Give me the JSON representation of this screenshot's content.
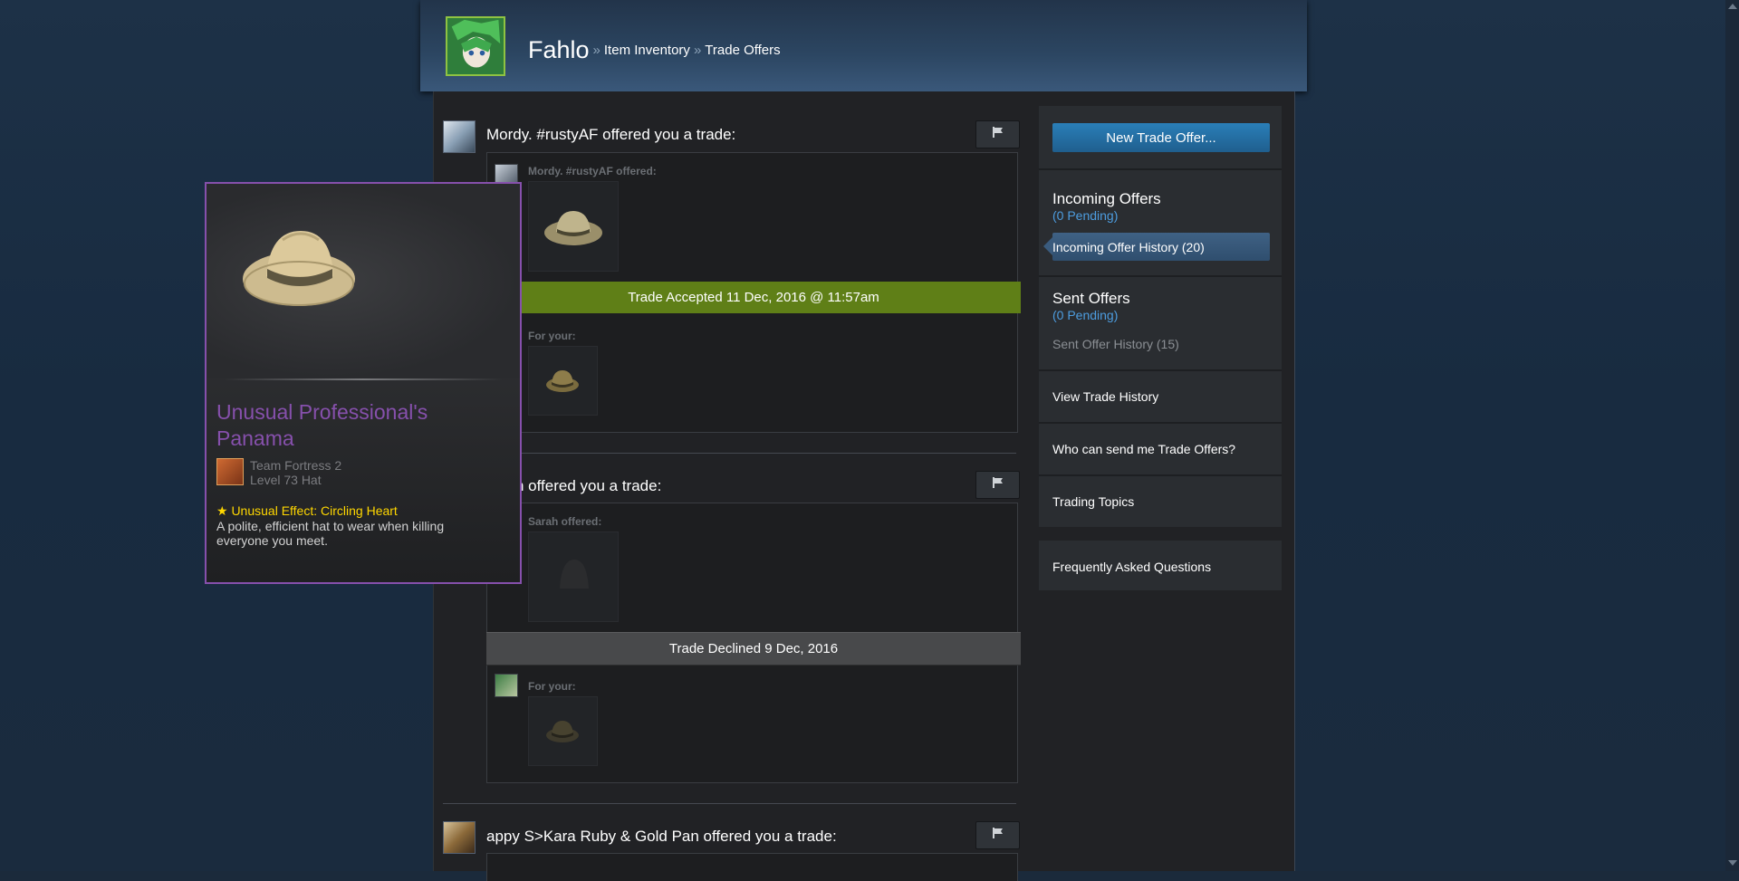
{
  "header": {
    "profile_name": "Fahlo",
    "separator": "»",
    "crumb_inventory": "Item Inventory",
    "crumb_trade_offers": "Trade Offers"
  },
  "offers": [
    {
      "title": "Mordy. #rustyAF offered you a trade:",
      "them_label": "Mordy. #rustyAF offered:",
      "status": "Trade Accepted 11 Dec, 2016 @ 11:57am",
      "status_kind": "accepted",
      "status_color": "#5f7f17",
      "your_label": "For your:"
    },
    {
      "title_visible": "n offered you a trade:",
      "them_label": "Sarah offered:",
      "status": "Trade Declined 9 Dec, 2016",
      "status_kind": "declined",
      "status_color": "#48494b",
      "your_label": "For your:"
    },
    {
      "title": "appy S>Kara Ruby & Gold Pan offered you a trade:"
    }
  ],
  "sidebar": {
    "new_offer": "New Trade Offer...",
    "incoming_head": "Incoming Offers",
    "incoming_pending": "(0 Pending)",
    "incoming_history": "Incoming Offer History (20)",
    "sent_head": "Sent Offers",
    "sent_pending": "(0 Pending)",
    "sent_history": "Sent Offer History (15)",
    "view_history": "View Trade History",
    "who_can_send": "Who can send me Trade Offers?",
    "trading_topics": "Trading Topics",
    "faq": "Frequently Asked Questions"
  },
  "tooltip": {
    "item_name": "Unusual Professional's Panama",
    "game": "Team Fortress 2",
    "level": "Level 73 Hat",
    "effect": "★ Unusual Effect: Circling Heart",
    "description": "A polite, efficient hat to wear when killing everyone you meet.",
    "name_color": "#8650ac",
    "effect_color": "#ffd700"
  },
  "icons": {
    "flag": "flag-icon",
    "hat": "panama-hat-icon",
    "game": "tf2-game-icon"
  },
  "colors": {
    "accent_blue": "#2a7fb8",
    "pending_blue": "#4d9de0",
    "accepted_green": "#5f7f17"
  }
}
